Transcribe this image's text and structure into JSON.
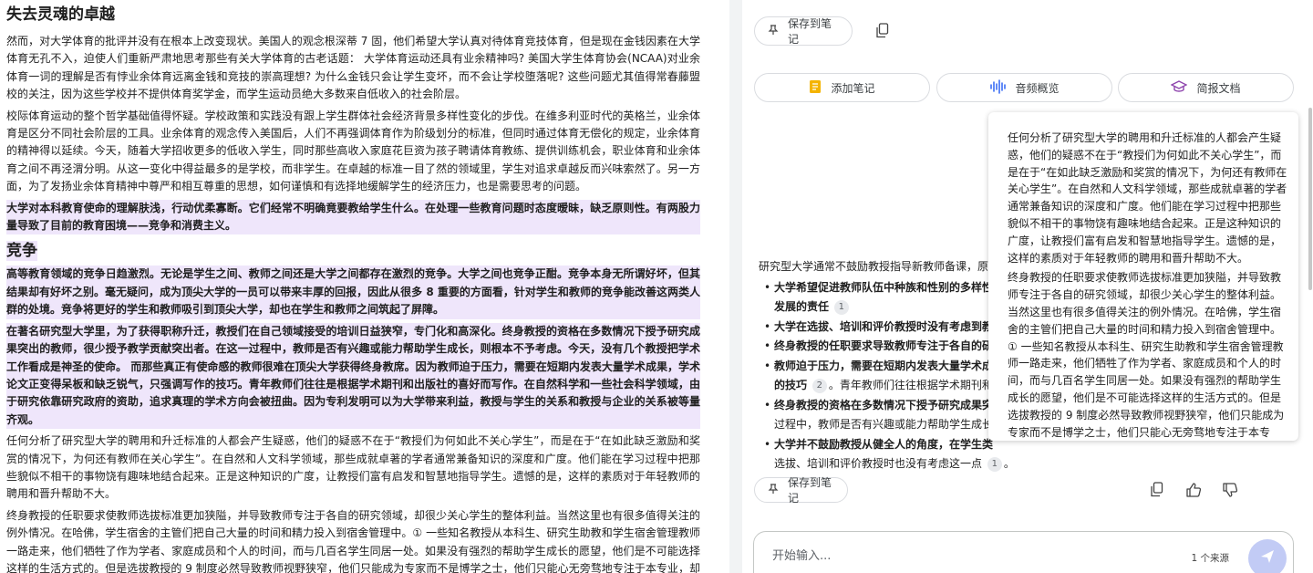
{
  "doc": {
    "title": "失去灵魂的卓越",
    "paragraphs": [
      {
        "text": "然而，对大学体育的批评并没有在根本上改变现状。美国人的观念根深蒂 7 固，他们希望大学认真对待体育竞技体育，但是现在金钱因素在大学体育无孔不入，迫使人们重新严肃地思考那些有关大学体育的古老话题： 大学体育运动还具有业余精神吗? 美国大学生体育协会(NCAA)对业余体育一词的理解是否有悖业余体育远离金钱和竞技的崇高理想? 为什么金钱只会让学生变坏，而不会让学校堕落呢? 这些问题尤其值得常春藤盟校的关注，因为这些学校并不提供体育奖学金，而学生运动员绝大多数来自低收入的社会阶层。",
        "hl": false
      },
      {
        "text": "校际体育运动的整个哲学基础值得怀疑。学校政策和实践没有跟上学生群体社会经济背景多样性变化的步伐。在维多利亚时代的英格兰，业余体育是区分不同社会阶层的工具。业余体育的观念传入美国后，人们不再强调体育作为阶级划分的标准，但同时通过体育无偿化的规定，业余体育的精神得以延续。今天，随着大学招收更多的低收入学生，同时那些高收入家庭花巨资为孩子聘请体育教练、提供训练机会，职业体育和业余体育之间不再泾渭分明。从这一变化中得益最多的是学校，而非学生。在卓越的标准一目了然的领域里，学生对追求卓越反而兴味索然了。另一方面，为了发扬业余体育精神中尊严和相互尊重的思想，如何谨慎和有选择地缓解学生的经济压力，也是需要思考的问题。",
        "hl": false
      },
      {
        "text": "大学对本科教育使命的理解肤浅，行动优柔寡断。它们经常不明确竟要教给学生什么。在处理一些教育问题时态度暧昧，缺乏原则性。有两股力量导致了目前的教育困境——竞争和消费主义。",
        "hl": true
      }
    ],
    "heading": "竞争",
    "paragraphs2": [
      {
        "text": "高等教育领域的竞争日趋激烈。无论是学生之间、教师之间还是大学之间都存在激烈的竞争。大学之间也竞争正酣。竞争本身无所谓好坏，但其结果却有好坏之别。毫无疑问，成为顶尖大学的一员可以带来丰厚的回报，因此从很多 8 重要的方面看，针对学生和教师的竞争能改善这两类人群的处境。竞争将更好的学生和教师吸引到顶尖大学，却也在学生和教师之间筑起了屏障。",
        "hl": true
      },
      {
        "text": "在著名研究型大学里，为了获得职称升迁，教授们在自己领域接受的培训日益狭窄，专门化和高深化。终身教授的资格在多数情况下授予研究成果突出的教师，很少授予教学贡献突出者。在这一过程中，教师是否有兴趣或能力帮助学生成长，则根本不予考虑。今天，没有几个教授把学术工作看成是神圣的使命。 而那些真正有使命感的教师很难在顶尖大学获得终身教席。因为教师迫于压力，需要在短期内发表大量学术成果，学术论文正变得呆板和缺乏锐气，只强调写作的技巧。青年教师们往往是根据学术期刊和出版社的喜好而写作。在自然科学和一些社会科学领域，由于研究依靠研究政府的资助，追求真理的学术方向会被扭曲。因为专利发明可以为大学带来利益，教授与学生的关系和教授与企业的关系被等量齐观。",
        "hl": true
      },
      {
        "text": "任何分析了研究型大学的聘用和升迁标准的人都会产生疑惑，他们的疑惑不在于“教授们为何如此不关心学生”，而是在于“在如此缺乏激励和奖赏的情况下，为何还有教师在关心学生”。在自然和人文科学领域，那些成就卓著的学者通常兼备知识的深度和广度。他们能在学习过程中把那些貌似不相干的事物饶有趣味地结合起来。正是这种知识的广度，让教授们富有启发和智慧地指导学生。遗憾的是，这样的素质对于年轻教师的聘用和晋升帮助不大。",
        "hl": false
      },
      {
        "text": "终身教授的任职要求使教师选拔标准更加狭隘，并导致教师专注于各自的研究领域，却很少关心学生的整体利益。当然这里也有很多值得关注的例外情况。在哈佛，学生宿舍的主管们把自己大量的时间和精力投入到宿舍管理中。① 一些知名教授从本科生、研究生助教和学生宿舍管理教师一路走来，他们牺牲了作为学者、家庭成员和个人的时间，而与几百名学生同居一处。如果没有强烈的帮助学生成长的愿望，他们是不可能选择这样的生活方式的。但是选拔教授的 9 制度必然导致教师视野狭窄，他们只能成为专家而不是博学之士，他们只能心无旁骛地专注于本专业，却无暇关心学生的身心发展。",
        "hl": false
      }
    ]
  },
  "chat": {
    "save_note_label": "保存到笔记",
    "studio": {
      "add_note": "添加笔记",
      "audio_overview": "音频概览",
      "briefing_doc": "简报文档"
    },
    "answer_intro": "研究型大学通常不鼓励教授指导新教师备课，原",
    "bullets": [
      {
        "bold": "大学希望促进教师队伍中种族和性别的多样性",
        "rest": "",
        "bold2": "发展的责任",
        "cite": "1"
      },
      {
        "bold": "大学在选拔、培训和评价教授时没有考虑到教",
        "rest": ""
      },
      {
        "bold": "终身教授的任职要求导致教师专注于各自的研",
        "rest": ""
      },
      {
        "bold": "教师迫于压力，需要在短期内发表大量学术成果",
        "rest2": "的技巧",
        "cite": "2",
        "tail": "。青年教师们往往根据学术期刊和"
      },
      {
        "bold": "终身教授的资格在多数情况下授予研究成果突出",
        "line2": "过程中，教师是否有兴趣或能力帮助学生成长"
      },
      {
        "bold": "大学并不鼓励教授从健全人的角度，在学生类",
        "line2": "选拔、培训和评价教授时也没有考虑这一点",
        "cite": "1"
      }
    ],
    "popover_paragraphs": [
      "任何分析了研究型大学的聘用和升迁标准的人都会产生疑惑，他们的疑惑不在于“教授们为何如此不关心学生”，而是在于“在如此缺乏激励和奖赏的情况下，为何还有教师在关心学生”。在自然和人文科学领域，那些成就卓著的学者通常兼备知识的深度和广度。他们能在学习过程中把那些貌似不相干的事物饶有趣味地结合起来。正是这种知识的广度，让教授们富有启发和智慧地指导学生。遗憾的是，这样的素质对于年轻教师的聘用和晋升帮助不大。",
      "终身教授的任职要求使教师选拔标准更加狭隘，并导致教师专注于各自的研究领域，却很少关心学生的整体利益。当然这里也有很多值得关注的例外情况。在哈佛，学生宿舍的主管们把自己大量的时间和精力投入到宿舍管理中。① 一些知名教授从本科生、研究生助教和学生宿舍管理教师一路走来，他们牺牲了作为学者、家庭成员和个人的时间，而与几百名学生同居一处。如果没有强烈的帮助学生成长的愿望，他们是不可能选择这样的生活方式的。但是选拔教授的 9 制度必然导致教师视野狭窄，他们只能成为专家而不是博学之士，他们只能心无旁骛地专注于本专业，却无暇关心学生的身心发展。"
    ],
    "input_placeholder": "开始输入...",
    "source_count": "1 个来源"
  },
  "colors": {
    "highlight": "#efe6fb",
    "send_button": "#c2cbf5",
    "note_icon": "#f4b400",
    "audio_icon": "#3b6ef5",
    "briefing_icon": "#8e44ad"
  },
  "icons": {
    "pin": "pin-icon",
    "copy": "copy-icon",
    "note": "note-icon",
    "audio": "audio-waveform-icon",
    "briefing": "graduation-cap-icon",
    "thumbs_up": "thumbs-up-icon",
    "thumbs_down": "thumbs-down-icon",
    "send": "send-icon"
  }
}
